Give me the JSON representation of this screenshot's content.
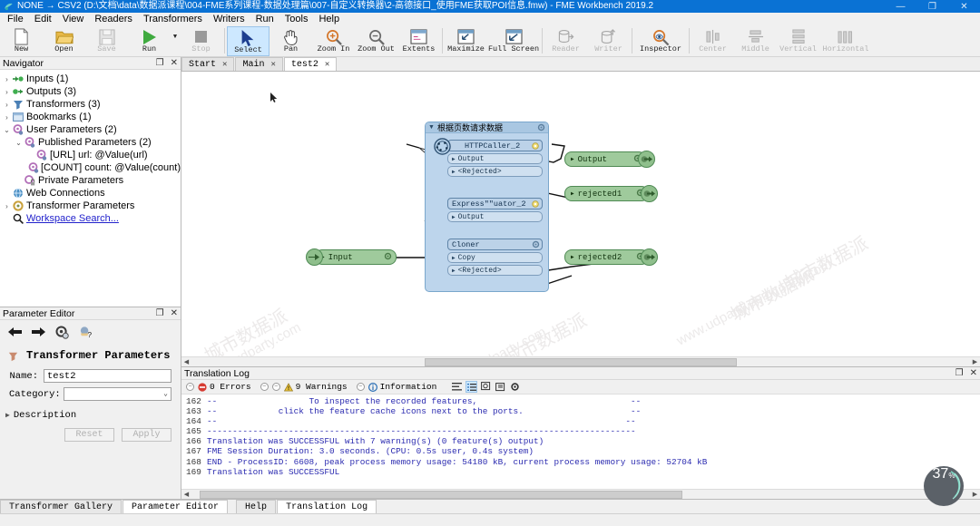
{
  "window": {
    "title": "NONE → CSV2 (D:\\文档\\data\\数据派课程\\004-FME系列课程-数据处理篇\\007-自定义转换器\\2-高德接口_使用FME获取POI信息.fmw) - FME Workbench 2019.2",
    "minimize": "—",
    "maximize": "❐",
    "close": "✕"
  },
  "menu": {
    "items": [
      "File",
      "Edit",
      "View",
      "Readers",
      "Transformers",
      "Writers",
      "Run",
      "Tools",
      "Help"
    ]
  },
  "toolbar": {
    "items": [
      {
        "label": "New",
        "icon": "new-document-icon",
        "state": "enabled"
      },
      {
        "label": "Open",
        "icon": "open-folder-icon",
        "state": "enabled"
      },
      {
        "label": "Save",
        "icon": "save-disk-icon",
        "state": "disabled"
      },
      {
        "label": "Run",
        "icon": "run-play-icon",
        "state": "enabled"
      },
      {
        "label": "Stop",
        "icon": "stop-square-icon",
        "state": "disabled"
      },
      {
        "label": "Select",
        "icon": "select-arrow-icon",
        "state": "active"
      },
      {
        "label": "Pan",
        "icon": "pan-hand-icon",
        "state": "enabled"
      },
      {
        "label": "Zoom In",
        "icon": "zoom-in-icon",
        "state": "enabled"
      },
      {
        "label": "Zoom Out",
        "icon": "zoom-out-icon",
        "state": "enabled"
      },
      {
        "label": "Extents",
        "icon": "extents-icon",
        "state": "enabled"
      },
      {
        "label": "Maximize",
        "icon": "maximize-icon",
        "state": "enabled"
      },
      {
        "label": "Full Screen",
        "icon": "full-screen-icon",
        "state": "enabled"
      },
      {
        "label": "Reader",
        "icon": "add-reader-icon",
        "state": "disabled"
      },
      {
        "label": "Writer",
        "icon": "add-writer-icon",
        "state": "disabled"
      },
      {
        "label": "Inspector",
        "icon": "inspector-icon",
        "state": "enabled"
      },
      {
        "label": "Center",
        "icon": "align-center-icon",
        "state": "disabled"
      },
      {
        "label": "Middle",
        "icon": "align-middle-icon",
        "state": "disabled"
      },
      {
        "label": "Vertical",
        "icon": "distribute-vertical-icon",
        "state": "disabled"
      },
      {
        "label": "Horizontal",
        "icon": "distribute-horizontal-icon",
        "state": "disabled"
      }
    ]
  },
  "navigator": {
    "title": "Navigator",
    "float_icon": "float-panel-icon",
    "close_icon": "close-icon",
    "items": [
      {
        "label": "Inputs (1)",
        "indent": 0,
        "arrow": "collapsed",
        "icon": "input-arrow-icon"
      },
      {
        "label": "Outputs (3)",
        "indent": 0,
        "arrow": "collapsed",
        "icon": "output-arrow-icon"
      },
      {
        "label": "Transformers (3)",
        "indent": 0,
        "arrow": "collapsed",
        "icon": "transformer-icon"
      },
      {
        "label": "Bookmarks (1)",
        "indent": 0,
        "arrow": "collapsed",
        "icon": "bookmark-icon"
      },
      {
        "label": "User Parameters (2)",
        "indent": 0,
        "arrow": "expanded",
        "icon": "user-parameter-icon"
      },
      {
        "label": "Published Parameters (2)",
        "indent": 1,
        "arrow": "expanded",
        "icon": "published-parameter-icon"
      },
      {
        "label": "[URL] url: @Value(url)",
        "indent": 2,
        "arrow": "none",
        "icon": "parameter-icon"
      },
      {
        "label": "[COUNT] count: @Value(count)",
        "indent": 2,
        "arrow": "none",
        "icon": "parameter-icon"
      },
      {
        "label": "Private Parameters",
        "indent": 1,
        "arrow": "none",
        "icon": "private-parameter-icon"
      },
      {
        "label": "Web Connections",
        "indent": 0,
        "arrow": "none",
        "icon": "web-connection-icon"
      },
      {
        "label": "Transformer Parameters",
        "indent": 0,
        "arrow": "collapsed",
        "icon": "transformer-parameter-icon"
      },
      {
        "label": "Workspace Search...",
        "indent": 0,
        "arrow": "none",
        "icon": "search-icon",
        "link": true
      }
    ]
  },
  "parameter_editor": {
    "title": "Parameter Editor",
    "float_icon": "float-panel-icon",
    "close_icon": "close-icon",
    "toolbar": [
      "back-arrow-icon",
      "forward-arrow-icon",
      "settings-gear-icon",
      "help-question-icon"
    ],
    "heading": "Transformer Parameters",
    "heading_icon": "transformer-icon",
    "fields": [
      {
        "label": "Name:",
        "value": "test2",
        "type": "text"
      },
      {
        "label": "Category:",
        "value": "",
        "type": "select"
      }
    ],
    "description_label": "Description",
    "buttons": [
      {
        "label": "Reset",
        "enabled": false
      },
      {
        "label": "Apply",
        "enabled": false
      }
    ]
  },
  "tabs": [
    {
      "label": "Start",
      "active": false,
      "close": "✕"
    },
    {
      "label": "Main",
      "active": false,
      "close": "✕"
    },
    {
      "label": "test2",
      "active": true,
      "close": "✕"
    }
  ],
  "canvas": {
    "zoom_level": "37",
    "zoom_suffix": "%",
    "bookmark": {
      "title": "根据页数请求数据",
      "gear_icon": "gear-icon",
      "collapse_icon": "triangle-down-icon"
    },
    "input_node": {
      "label": "Input",
      "gear_icon": "gear-icon",
      "port_icon": "port-triangle-icon"
    },
    "transformers": [
      {
        "name": "HTTPCaller_2",
        "icon": "http-caller-icon",
        "gear_icon": "sun-gear-icon",
        "ports": [
          "Output",
          "<Rejected>"
        ]
      },
      {
        "name": "Express\"\"uator_2",
        "icon": "expression-evaluator-icon",
        "gear_icon": "sun-gear-icon",
        "ports": [
          "Output"
        ]
      },
      {
        "name": "Cloner",
        "icon": "cloner-icon",
        "gear_icon": "gear-icon",
        "ports": [
          "Copy",
          "<Rejected>"
        ]
      }
    ],
    "outputs": [
      {
        "label": "Output",
        "gear_icon": "gear-icon"
      },
      {
        "label": "rejected1",
        "gear_icon": "gear-icon"
      },
      {
        "label": "rejected2",
        "gear_icon": "gear-icon"
      }
    ],
    "watermarks": [
      "城市数据派",
      "www.udparty.com"
    ]
  },
  "log": {
    "title": "Translation Log",
    "float_icon": "float-panel-icon",
    "close_icon": "close-icon",
    "filters": [
      {
        "label": "0 Errors",
        "icon": "error-icon"
      },
      {
        "label": "9 Warnings",
        "icon": "warning-icon"
      },
      {
        "label": "Information",
        "icon": "information-icon"
      }
    ],
    "tool_icons": [
      "wrap-text-icon",
      "list-view-icon",
      "find-icon",
      "find-next-icon",
      "settings-gear-icon"
    ],
    "lines": [
      {
        "num": "162",
        "text": "--                  To inspect the recorded features,                              --"
      },
      {
        "num": "163",
        "text": "--            click the feature cache icons next to the ports.                     --"
      },
      {
        "num": "164",
        "text": "--                                                                                --"
      },
      {
        "num": "165",
        "text": "------------------------------------------------------------------------------------"
      },
      {
        "num": "166",
        "text": "Translation was SUCCESSFUL with 7 warning(s) (0 feature(s) output)"
      },
      {
        "num": "167",
        "text": "FME Session Duration: 3.0 seconds. (CPU: 0.5s user, 0.4s system)"
      },
      {
        "num": "168",
        "text": "END - ProcessID: 6608, peak process memory usage: 54180 kB, current process memory usage: 52704 kB"
      },
      {
        "num": "169",
        "text": "Translation was SUCCESSFUL"
      }
    ]
  },
  "status_tabs": [
    {
      "label": "Transformer Gallery",
      "active": false
    },
    {
      "label": "Parameter Editor",
      "active": true
    },
    {
      "label": "Help",
      "active": false
    },
    {
      "label": "Translation Log",
      "active": true
    }
  ]
}
